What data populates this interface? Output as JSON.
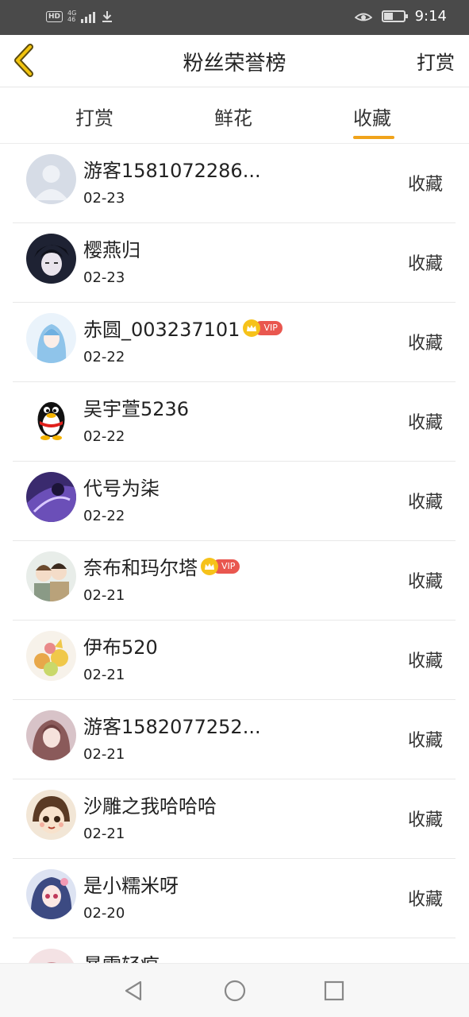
{
  "status_bar": {
    "hd": "HD",
    "network_top": "4G",
    "network_bottom": "46",
    "time": "9:14",
    "battery_level": 0.45
  },
  "header": {
    "title": "粉丝荣誉榜",
    "action_label": "打赏",
    "back_icon": "chevron-left-icon"
  },
  "tabs": {
    "items": [
      {
        "label": "打赏"
      },
      {
        "label": "鲜花"
      },
      {
        "label": "收藏"
      }
    ],
    "active_index": 2,
    "accent_color": "#f0a31b"
  },
  "fans": {
    "items": [
      {
        "name": "游客1581072286...",
        "date": "02-23",
        "action": "收藏",
        "vip": false
      },
      {
        "name": "樱燕归",
        "date": "02-23",
        "action": "收藏",
        "vip": false
      },
      {
        "name": "赤圆_003237101",
        "date": "02-22",
        "action": "收藏",
        "vip": true,
        "vip_label": "VIP"
      },
      {
        "name": "吴宇萱5236",
        "date": "02-22",
        "action": "收藏",
        "vip": false
      },
      {
        "name": "代号为柒",
        "date": "02-22",
        "action": "收藏",
        "vip": false
      },
      {
        "name": "奈布和玛尔塔",
        "date": "02-21",
        "action": "收藏",
        "vip": true,
        "vip_label": "VIP"
      },
      {
        "name": "伊布520",
        "date": "02-21",
        "action": "收藏",
        "vip": false
      },
      {
        "name": "游客1582077252...",
        "date": "02-21",
        "action": "收藏",
        "vip": false
      },
      {
        "name": "沙雕之我哈哈哈",
        "date": "02-21",
        "action": "收藏",
        "vip": false
      },
      {
        "name": "是小糯米呀",
        "date": "02-20",
        "action": "收藏",
        "vip": false
      },
      {
        "name": "暴雪轻痕",
        "date": "",
        "action": "",
        "vip": false
      }
    ]
  },
  "nav_bar": {
    "icons": [
      "back-triangle-icon",
      "home-circle-icon",
      "recents-square-icon"
    ]
  }
}
